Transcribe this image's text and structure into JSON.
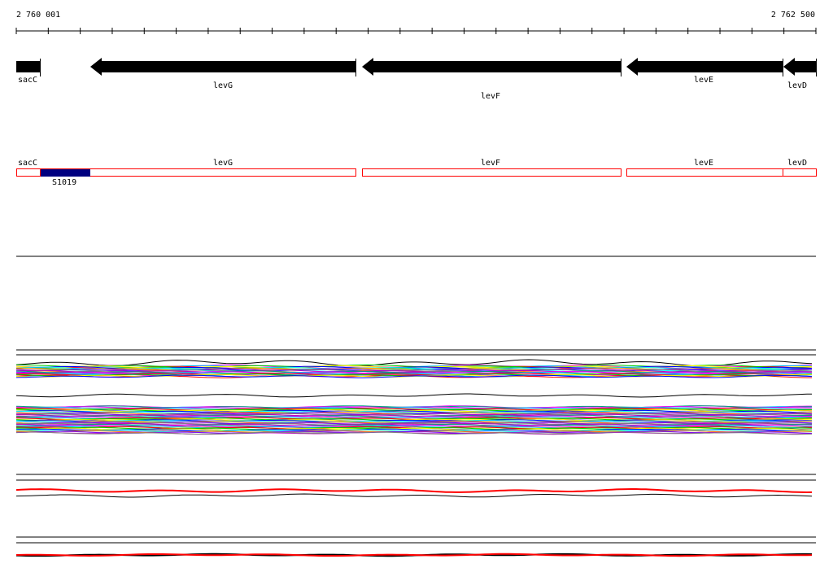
{
  "ruler": {
    "start_label": "2 760 001",
    "end_label": "2 762 500"
  },
  "genes": [
    {
      "name": "sacC"
    },
    {
      "name": "levG"
    },
    {
      "name": "levF"
    },
    {
      "name": "levE"
    },
    {
      "name": "levD"
    }
  ],
  "features": [
    {
      "name": "S1019"
    }
  ],
  "colors": {
    "gene_arrow": "#000000",
    "feature_outline": "#ff0000",
    "feature_fill": "#000080",
    "track_line": "#000000"
  }
}
